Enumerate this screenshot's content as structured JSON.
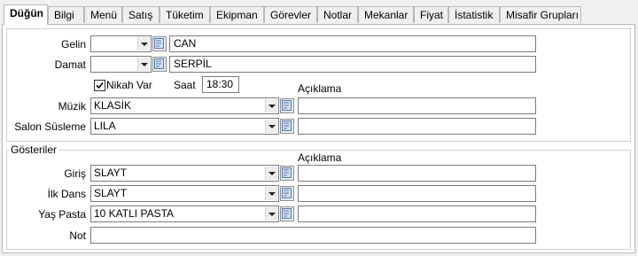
{
  "tabs": [
    {
      "label": "Düğün",
      "active": true
    },
    {
      "label": "Bilgi"
    },
    {
      "label": "Menü"
    },
    {
      "label": "Satış"
    },
    {
      "label": "Tüketim"
    },
    {
      "label": "Ekipman"
    },
    {
      "label": "Görevler"
    },
    {
      "label": "Notlar"
    },
    {
      "label": "Mekanlar"
    },
    {
      "label": "Fiyat"
    },
    {
      "label": "İstatistik"
    },
    {
      "label": "Misafir Grupları"
    }
  ],
  "form": {
    "gelin": {
      "label": "Gelin",
      "select_value": "",
      "name_value": "CAN"
    },
    "damat": {
      "label": "Damat",
      "select_value": "",
      "name_value": "SERPİL"
    },
    "nikah": {
      "label": "Nikah Var",
      "checked": true
    },
    "saat": {
      "label": "Saat",
      "value": "18:30"
    },
    "aciklama_header": "Açıklama",
    "muzik": {
      "label": "Müzik",
      "value": "KLASİK",
      "note": ""
    },
    "salon": {
      "label": "Salon Süsleme",
      "value": "LILA",
      "note": ""
    }
  },
  "gosteriler": {
    "title": "Gösteriler",
    "aciklama_header": "Açıklama",
    "giris": {
      "label": "Giriş",
      "value": "SLAYT",
      "note": ""
    },
    "ilk_dans": {
      "label": "İlk Dans",
      "value": "SLAYT",
      "note": ""
    },
    "yas_pasta": {
      "label": "Yaş Pasta",
      "value": "10 KATLI PASTA",
      "note": ""
    },
    "not": {
      "label": "Not",
      "value": ""
    }
  }
}
